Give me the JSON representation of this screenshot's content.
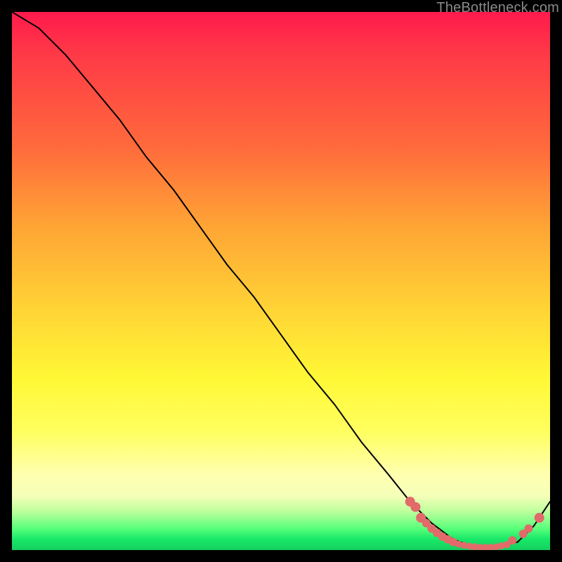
{
  "watermark": "TheBottleneck.com",
  "chart_data": {
    "type": "line",
    "title": "",
    "xlabel": "",
    "ylabel": "",
    "xlim": [
      0,
      100
    ],
    "ylim": [
      0,
      100
    ],
    "series": [
      {
        "name": "curve",
        "x": [
          0,
          5,
          10,
          15,
          20,
          25,
          30,
          35,
          40,
          45,
          50,
          55,
          60,
          65,
          70,
          74,
          78,
          82,
          86,
          90,
          94,
          97,
          100
        ],
        "values": [
          100,
          97,
          92,
          86,
          80,
          73,
          67,
          60,
          53,
          47,
          40,
          33,
          27,
          20,
          14,
          9,
          5,
          2,
          0.5,
          0.5,
          1.5,
          4.5,
          9
        ]
      }
    ],
    "markers": {
      "name": "highlight-points",
      "color": "#e26a6a",
      "x": [
        74,
        75,
        76,
        77,
        78,
        79,
        80,
        81,
        82,
        83,
        84,
        85,
        86,
        87,
        88,
        89,
        90,
        91,
        92,
        93,
        95,
        96,
        98
      ],
      "values": [
        9,
        8,
        6,
        5,
        4,
        3.2,
        2.5,
        2,
        1.5,
        1.1,
        0.9,
        0.7,
        0.6,
        0.5,
        0.5,
        0.5,
        0.6,
        0.8,
        1.0,
        1.8,
        3,
        4,
        6
      ]
    }
  }
}
